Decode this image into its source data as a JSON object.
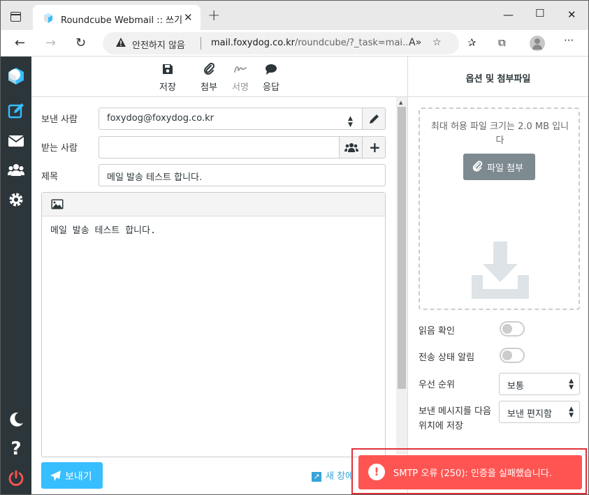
{
  "browser": {
    "tab_title": "Roundcube Webmail :: 쓰기",
    "not_secure": "안전하지 않음",
    "url_host": "mail.foxydog.co.kr",
    "url_path": "/roundcube/?_task=mai..."
  },
  "toolbar": {
    "save": "저장",
    "attach": "첨부",
    "signature": "서명",
    "responses": "응답"
  },
  "compose": {
    "from_label": "보낸 사람",
    "from_value": "foxydog@foxydog.co.kr",
    "to_label": "받는 사람",
    "to_value": "",
    "subject_label": "제목",
    "subject_value": "메일 발송 테스트 합니다.",
    "body": "메일 발송 테스트 합니다.",
    "send": "보내기",
    "new_window": "새 창에"
  },
  "panel": {
    "title": "옵션 및 첨부파일",
    "max_size": "최대 허용 파일 크기는 2.0 MB 입니다",
    "attach_file": "파일 첨부",
    "read_receipt": "읽음 확인",
    "delivery_status": "전송 상태 알림",
    "priority_label": "우선 순위",
    "priority_value": "보통",
    "save_sent_label": "보낸 메시지를 다음 위치에 저장",
    "save_sent_value": "보낸 편지함"
  },
  "alert": {
    "message": "SMTP 오류 (250): 인증을 실패했습니다."
  },
  "colors": {
    "sidebar": "#2c363a",
    "accent": "#37beff",
    "error": "#ff5552"
  }
}
